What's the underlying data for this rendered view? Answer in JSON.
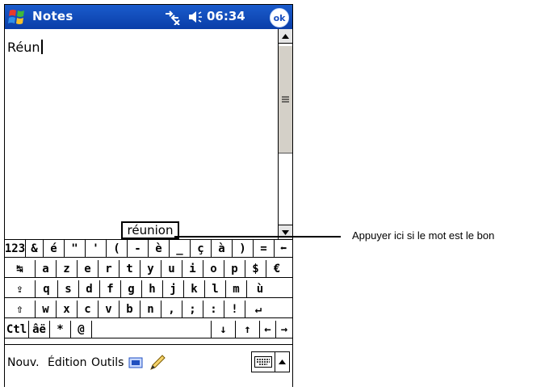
{
  "titlebar": {
    "app_title": "Notes",
    "clock": "06:34",
    "ok_label": "ok",
    "background_color": "#1a4fc0"
  },
  "note": {
    "text": "Réun"
  },
  "suggestion": {
    "word": "réunion"
  },
  "keyboard": {
    "rows": [
      [
        "123",
        "&",
        "é",
        "\"",
        "'",
        "(",
        "-",
        "è",
        "_",
        "ç",
        "à",
        ")",
        "=",
        "⬅"
      ],
      [
        "↹",
        "a",
        "z",
        "e",
        "r",
        "t",
        "y",
        "u",
        "i",
        "o",
        "p",
        "$",
        "€"
      ],
      [
        "⇪",
        "q",
        "s",
        "d",
        "f",
        "g",
        "h",
        "j",
        "k",
        "l",
        "m",
        "ù"
      ],
      [
        "⇧",
        "w",
        "x",
        "c",
        "v",
        "b",
        "n",
        ",",
        ";",
        ":",
        "!",
        "↵"
      ],
      [
        "Ctl",
        "âë",
        "*",
        "@",
        " ",
        "↓",
        "↑",
        "←",
        "→"
      ]
    ]
  },
  "menubar": {
    "nouv": "Nouv.",
    "edition": "Édition",
    "outils": "Outils"
  },
  "callout": {
    "text": "Appuyer ici si le mot est le bon"
  },
  "icons": {
    "start": "windows-flag-icon",
    "connectivity": "connectivity-icon",
    "volume": "speaker-icon",
    "record": "recording-icon",
    "pen": "pen-icon",
    "keyboard": "keyboard-icon"
  }
}
